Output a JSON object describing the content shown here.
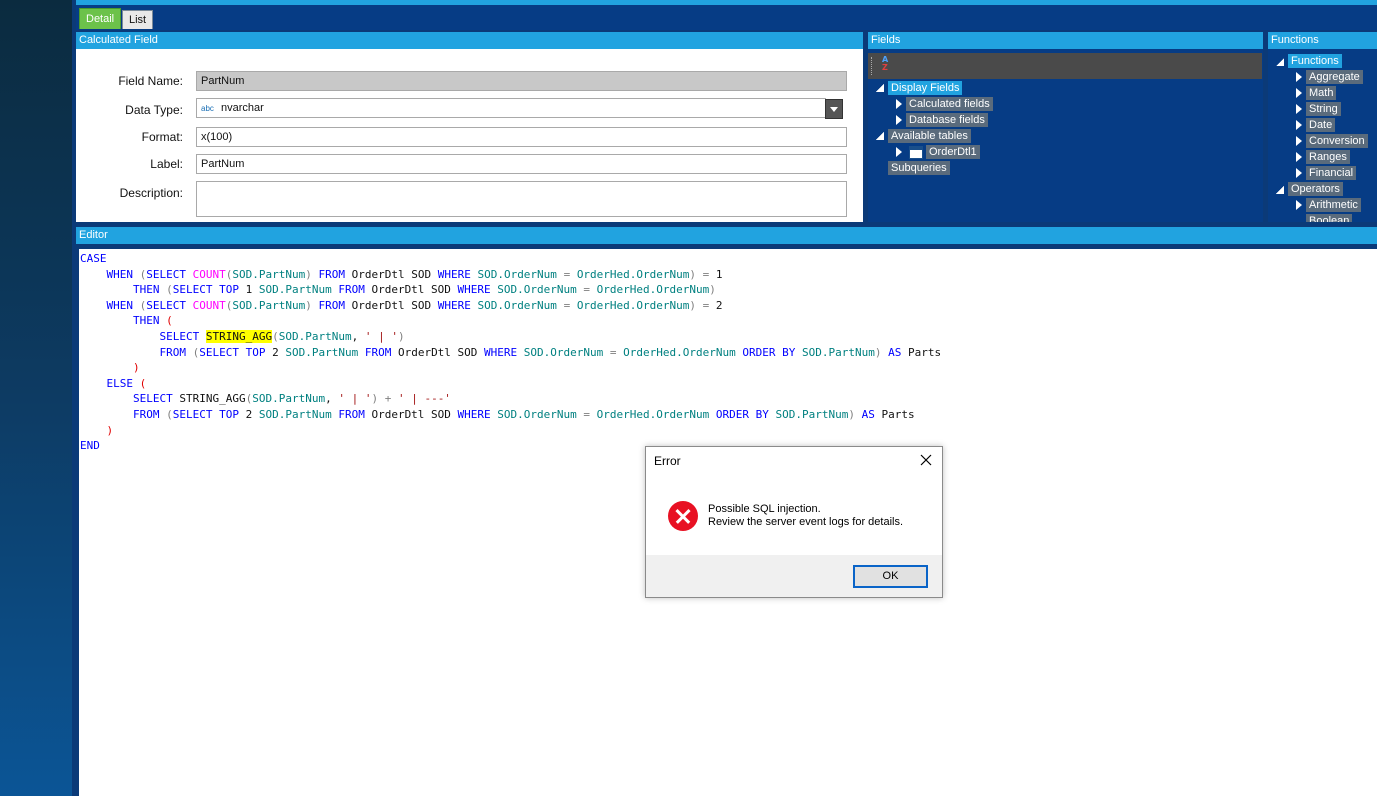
{
  "tabs": {
    "detail": "Detail",
    "list": "List"
  },
  "calc_field": {
    "header": "Calculated Field",
    "field_name_label": "Field Name:",
    "field_name_value": "PartNum",
    "data_type_label": "Data Type:",
    "data_type_prefix": "abc",
    "data_type_value": "nvarchar",
    "format_label": "Format:",
    "format_value": "x(100)",
    "label_label": "Label:",
    "label_value": "PartNum",
    "description_label": "Description:",
    "description_value": ""
  },
  "fields": {
    "header": "Fields",
    "display_fields": "Display Fields",
    "calculated_fields": "Calculated fields",
    "database_fields": "Database fields",
    "available_tables": "Available tables",
    "table_orderdtl1": "OrderDtl1",
    "subqueries": "Subqueries"
  },
  "functions": {
    "header": "Functions",
    "root": "Functions",
    "items": [
      "Aggregate",
      "Math",
      "String",
      "Date",
      "Conversion",
      "Ranges",
      "Financial"
    ],
    "operators": "Operators",
    "arithmetic": "Arithmetic",
    "boolean_partial": "Boolean"
  },
  "editor": {
    "header": "Editor"
  },
  "dialog": {
    "title": "Error",
    "line1": "Possible SQL injection.",
    "line2": "Review the server event logs for details.",
    "ok": "OK"
  },
  "icons": {
    "sort": "sort-az-icon",
    "close": "close-icon",
    "error": "error-circle-icon",
    "table": "table-icon"
  },
  "colors": {
    "accent": "#21a3e0",
    "panel_bg": "#063c85",
    "active_tab": "#6cc24a",
    "error_red": "#e81123",
    "highlight": "#ffff00"
  }
}
